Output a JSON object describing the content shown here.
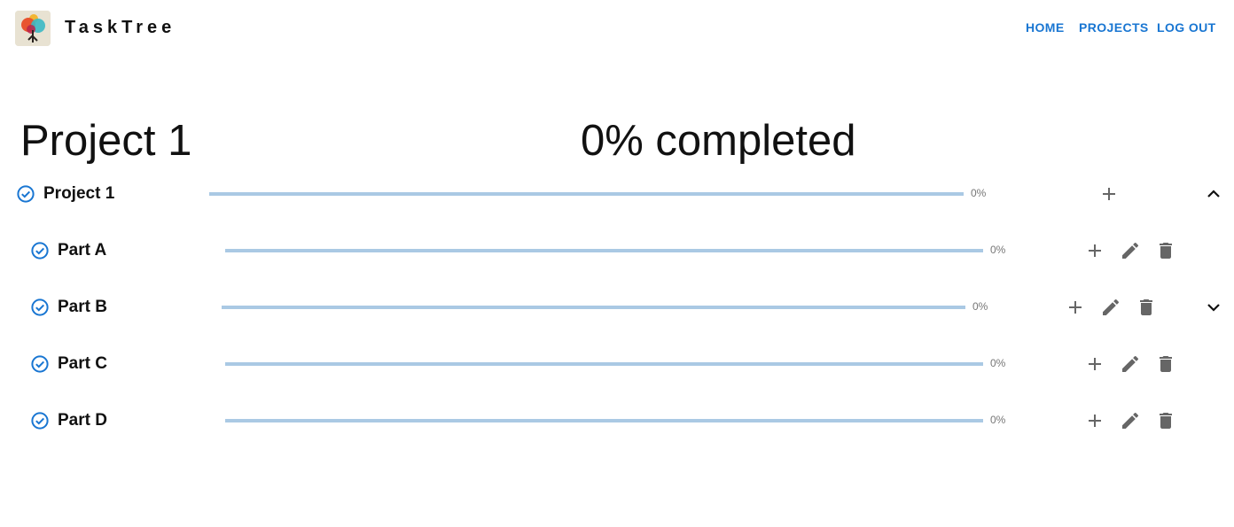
{
  "header": {
    "brand": "TaskTree",
    "nav": [
      {
        "label": "HOME"
      },
      {
        "label": "PROJECTS"
      },
      {
        "label": "LOG OUT"
      }
    ]
  },
  "page": {
    "project_title": "Project 1",
    "completed_label": "0% completed"
  },
  "tree": [
    {
      "label": "Project 1",
      "progress_text": "0%",
      "progress": 0,
      "expanded": true
    },
    {
      "label": "Part A",
      "progress_text": "0%",
      "progress": 0
    },
    {
      "label": "Part B",
      "progress_text": "0%",
      "progress": 0,
      "expanded": false
    },
    {
      "label": "Part C",
      "progress_text": "0%",
      "progress": 0
    },
    {
      "label": "Part D",
      "progress_text": "0%",
      "progress": 0
    }
  ],
  "colors": {
    "accent": "#1976d2",
    "track": "#aac9e4",
    "icon": "#666666"
  },
  "icons": [
    "check-circle-icon",
    "plus-icon",
    "pencil-icon",
    "trash-icon",
    "chevron-up-icon",
    "chevron-down-icon"
  ]
}
